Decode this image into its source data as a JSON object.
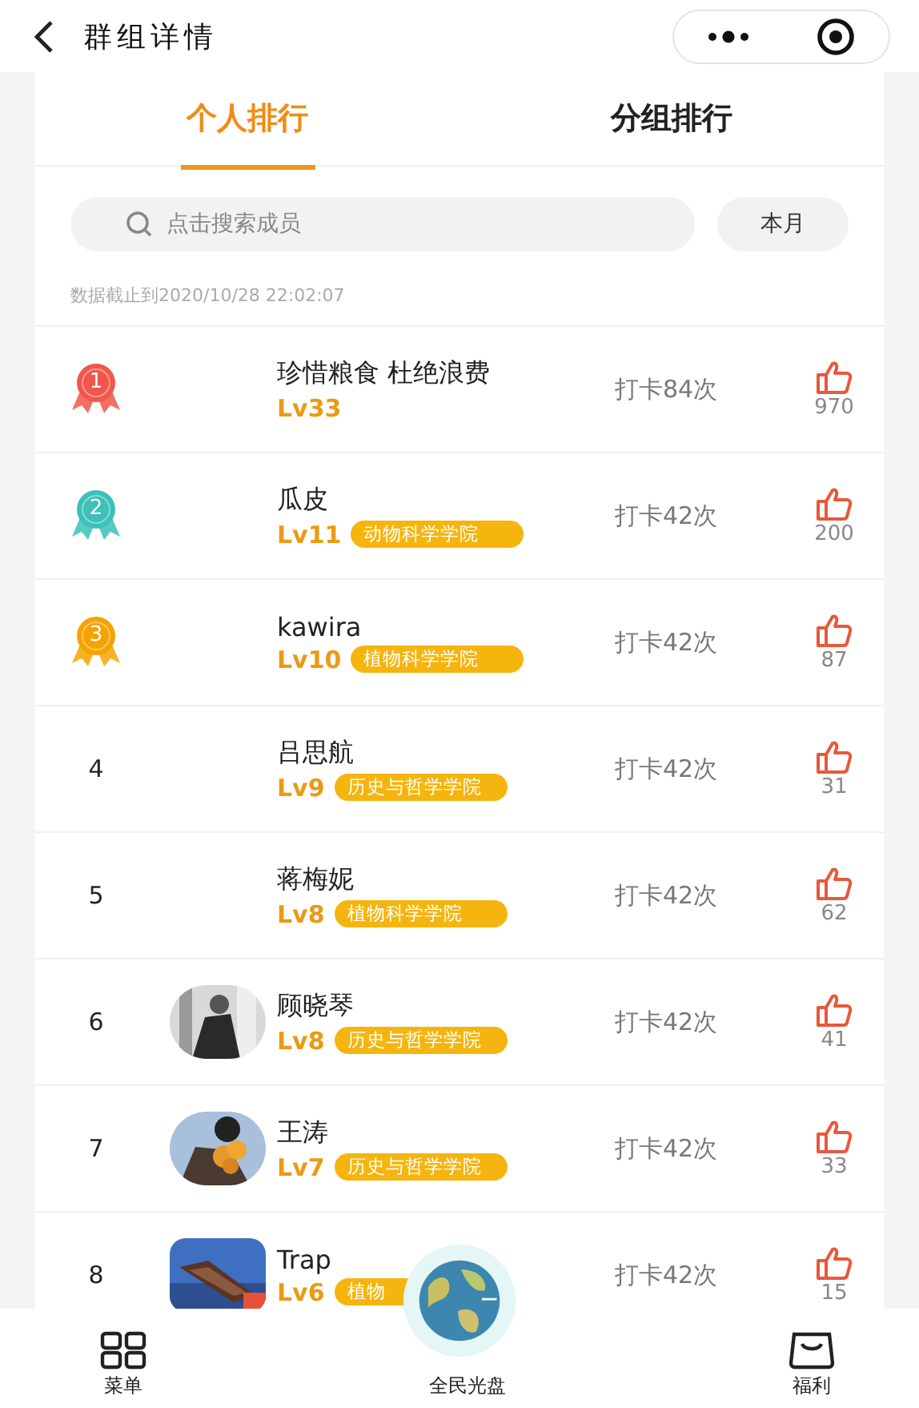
{
  "header": {
    "title": "群组详情"
  },
  "tabs": [
    {
      "label": "个人排行",
      "selected": true
    },
    {
      "label": "分组排行",
      "selected": false
    }
  ],
  "search": {
    "placeholder": "点击搜索成员"
  },
  "period": "本月",
  "updated": "数据截止到2020/10/28 22:02:07",
  "rows": [
    {
      "kind": "medal",
      "rank": "1",
      "color": "#f0574a",
      "name": "珍惜粮食 杜绝浪费",
      "level": "Lv33",
      "checkins": "打卡84次",
      "likes": "970"
    },
    {
      "kind": "medal",
      "rank": "2",
      "color": "#3cc0b8",
      "name": "瓜皮",
      "level": "Lv11",
      "tag": "动物科学学院",
      "checkins": "打卡42次",
      "likes": "200"
    },
    {
      "kind": "medal",
      "rank": "3",
      "color": "#f5a300",
      "name": "kawira",
      "level": "Lv10",
      "tag": "植物科学学院",
      "checkins": "打卡42次",
      "likes": "87"
    },
    {
      "kind": "number",
      "rank": "4",
      "name": "吕思航",
      "level": "Lv9",
      "tag": "历史与哲学学院",
      "checkins": "打卡42次",
      "likes": "31"
    },
    {
      "kind": "number",
      "rank": "5",
      "name": "蒋梅妮",
      "level": "Lv8",
      "tag": "植物科学学院",
      "checkins": "打卡42次",
      "likes": "62"
    },
    {
      "kind": "number",
      "rank": "6",
      "name": "顾晓琴",
      "level": "Lv8",
      "tag": "历史与哲学学院",
      "checkins": "打卡42次",
      "likes": "41"
    },
    {
      "kind": "number",
      "rank": "7",
      "name": "王涛",
      "level": "Lv7",
      "tag": "历史与哲学学院",
      "checkins": "打卡42次",
      "likes": "33"
    },
    {
      "kind": "number",
      "rank": "8",
      "name": "Trap",
      "level": "Lv6",
      "tag": "植物",
      "checkins": "打卡42次",
      "likes": "15"
    }
  ],
  "nav": [
    {
      "kind": "menu",
      "label": "菜单"
    },
    {
      "kind": "globe",
      "label": "全民光盘"
    },
    {
      "kind": "bag",
      "label": "福利"
    }
  ]
}
